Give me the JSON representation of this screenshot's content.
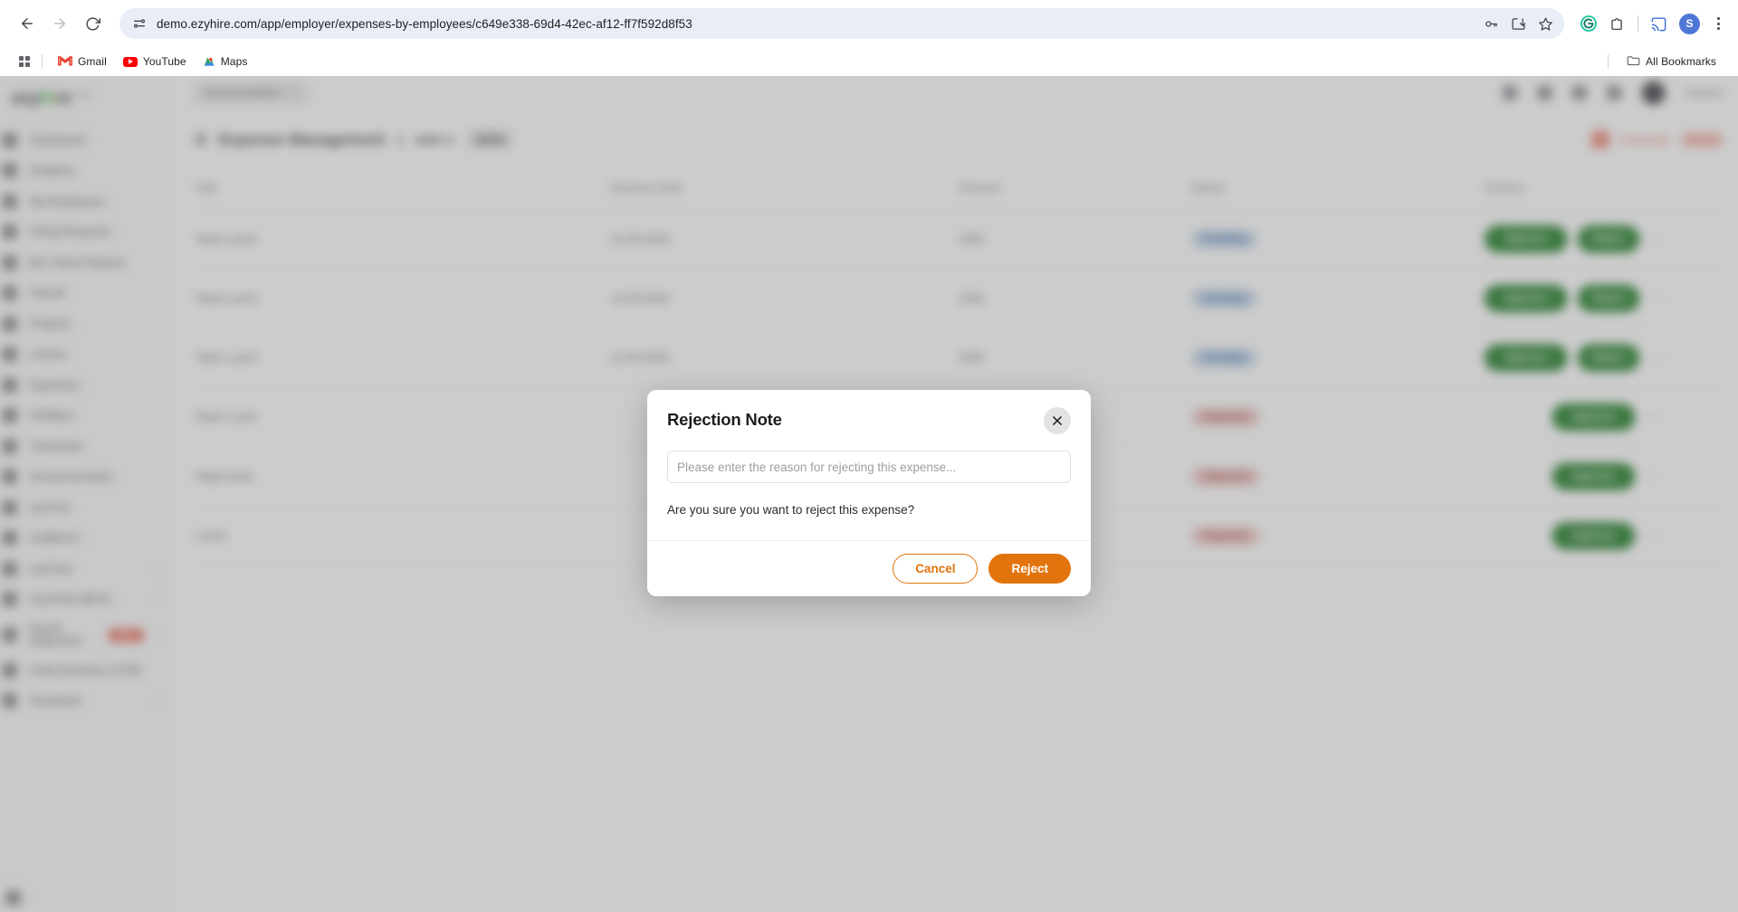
{
  "browser": {
    "back_label": "Back",
    "forward_label": "Forward",
    "reload_label": "Reload",
    "url": "demo.ezyhire.com/app/employer/expenses-by-employees/c649e338-69d4-42ec-af12-ff7f592d8f53",
    "site_settings_icon": "tune-icon",
    "omnibox_icons": [
      "password-key-icon",
      "install-app-icon",
      "bookmark-star-icon"
    ],
    "extension_icons": [
      "grammarly-icon",
      "extensions-puzzle-icon",
      "cast-icon"
    ],
    "profile_initial": "S",
    "menu_icon": "kebab-menu-icon"
  },
  "bookmarks": {
    "apps_icon": "apps-grid-icon",
    "items": [
      {
        "label": "Gmail",
        "icon": "gmail-icon"
      },
      {
        "label": "YouTube",
        "icon": "youtube-icon"
      },
      {
        "label": "Maps",
        "icon": "maps-icon"
      }
    ],
    "all_bookmarks_label": "All Bookmarks",
    "all_bookmarks_icon": "folder-icon"
  },
  "app": {
    "logo": {
      "prefix": "ezy",
      "mid_a": "h",
      "mid_b": "i",
      "suffix": "re",
      "tld": ".com"
    },
    "sidebar": {
      "items": [
        {
          "label": "Dashboard",
          "icon": "dashboard-icon"
        },
        {
          "label": "Analytics",
          "icon": "analytics-icon"
        },
        {
          "label": "My Employees",
          "icon": "employees-icon"
        },
        {
          "label": "Hiring Requests",
          "icon": "hiring-icon"
        },
        {
          "label": "BG Check Reports",
          "icon": "report-icon"
        },
        {
          "label": "Payroll",
          "icon": "payroll-icon"
        },
        {
          "label": "Projects",
          "icon": "projects-icon"
        },
        {
          "label": "Leaves",
          "icon": "leaves-icon"
        },
        {
          "label": "Expenses",
          "icon": "expenses-icon"
        },
        {
          "label": "Holidays",
          "icon": "holidays-icon"
        },
        {
          "label": "Timesheet",
          "icon": "timesheet-icon"
        },
        {
          "label": "Announcements",
          "icon": "announcements-icon"
        },
        {
          "label": "ezyTrial",
          "icon": "ezytrial-icon"
        },
        {
          "label": "ezyBench",
          "icon": "ezybench-icon"
        },
        {
          "label": "ezyTime",
          "icon": "ezytime-icon",
          "caret": "›"
        },
        {
          "label": "ezyVerify (BGV)",
          "icon": "ezyverify-icon",
          "caret": "›"
        },
        {
          "label": "Export Statement",
          "icon": "export-icon",
          "badge": "New",
          "caret": "›"
        },
        {
          "label": "Verify Business (KYB)",
          "icon": "kyb-icon"
        },
        {
          "label": "Developer",
          "icon": "developer-icon",
          "caret": "›"
        }
      ],
      "collapse_icon": "collapse-icon"
    },
    "topbar": {
      "breadcrumb_pill": "Documentation",
      "breadcrumb_close_icon": "close-small-icon",
      "icons": [
        "feedback-icon",
        "help-icon",
        "support-icon",
        "search-icon"
      ],
      "avatar_icon": "user-avatar",
      "user_name": "Sanjeev"
    },
    "page_header": {
      "back_icon": "chevron-left-icon",
      "title": "Expense Management",
      "separator": "|",
      "subtitle": "sam s",
      "chip": "2024",
      "alert_icon": "alert-icon",
      "action_link": "Generate",
      "action_pill": "Link"
    },
    "table": {
      "columns": [
        "Title",
        "Expense Date",
        "Amount",
        "Status",
        "Actions"
      ],
      "rows": [
        {
          "title": "Team Lunch",
          "date": "12-05-2024",
          "amount": "1500",
          "status": "Pending",
          "status_kind": "pending",
          "actions": [
            "Approve",
            "Reject"
          ]
        },
        {
          "title": "Team Lunch",
          "date": "12-05-2024",
          "amount": "1500",
          "status": "Pending",
          "status_kind": "pending",
          "actions": [
            "Approve",
            "Reject"
          ]
        },
        {
          "title": "Team Lunch",
          "date": "12-05-2024",
          "amount": "1500",
          "status": "Pending",
          "status_kind": "pending",
          "actions": [
            "Approve",
            "Reject"
          ]
        },
        {
          "title": "Team Lunch",
          "date": "",
          "amount": "",
          "status": "Rejected",
          "status_kind": "rejected",
          "actions": [
            "Approve"
          ]
        },
        {
          "title": "Flight ticket",
          "date": "",
          "amount": "",
          "status": "Rejected",
          "status_kind": "rejected",
          "actions": [
            "Approve"
          ]
        },
        {
          "title": "Lunch",
          "date": "",
          "amount": "",
          "status": "Rejected",
          "status_kind": "rejected",
          "actions": [
            "Approve"
          ]
        }
      ],
      "row_menu_icon": "more-horizontal-icon"
    }
  },
  "modal": {
    "title": "Rejection Note",
    "close_icon": "close-icon",
    "input_placeholder": "Please enter the reason for rejecting this expense...",
    "input_value": "",
    "question": "Are you sure you want to reject this expense?",
    "cancel_label": "Cancel",
    "reject_label": "Reject"
  },
  "colors": {
    "brand_orange": "#e2740d",
    "approve_green": "#1a7a22",
    "pending_badge": "#bed2e8",
    "rejected_badge": "#ecc3c1",
    "badge_red": "#e8604c",
    "omnibox_bg": "#e9eef6"
  }
}
